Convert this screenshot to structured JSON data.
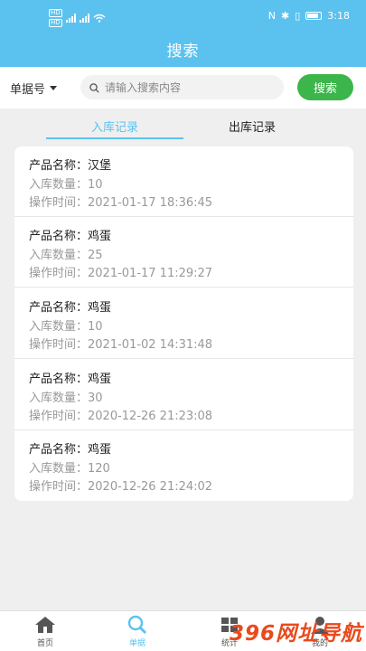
{
  "status_bar": {
    "time": "3:18"
  },
  "header": {
    "title": "搜索"
  },
  "search": {
    "filter_label": "单据号",
    "placeholder": "请输入搜索内容",
    "button_label": "搜索"
  },
  "tabs": [
    {
      "label": "入库记录",
      "active": true
    },
    {
      "label": "出库记录",
      "active": false
    }
  ],
  "records": [
    {
      "product": "产品名称：汉堡",
      "quantity": "入库数量：10",
      "time": "操作时间：2021-01-17 18:36:45"
    },
    {
      "product": "产品名称：鸡蛋",
      "quantity": "入库数量：25",
      "time": "操作时间：2021-01-17 11:29:27"
    },
    {
      "product": "产品名称：鸡蛋",
      "quantity": "入库数量：10",
      "time": "操作时间：2021-01-02 14:31:48"
    },
    {
      "product": "产品名称：鸡蛋",
      "quantity": "入库数量：30",
      "time": "操作时间：2020-12-26 21:23:08"
    },
    {
      "product": "产品名称：鸡蛋",
      "quantity": "入库数量：120",
      "time": "操作时间：2020-12-26 21:24:02"
    }
  ],
  "bottom_nav": [
    {
      "label": "首页",
      "icon": "home-icon"
    },
    {
      "label": "单据",
      "icon": "search-icon",
      "active": true
    },
    {
      "label": "统计",
      "icon": "stats-icon"
    },
    {
      "label": "我的",
      "icon": "user-icon"
    }
  ],
  "watermark": "396网址导航",
  "colors": {
    "header": "#5bc2f0",
    "search_button": "#3cb54a",
    "active_tab": "#5bc2f0"
  }
}
